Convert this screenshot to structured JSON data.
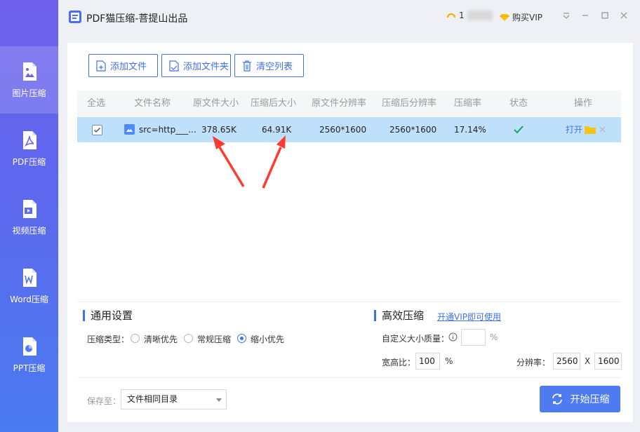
{
  "app": {
    "title": "PDF猫压缩-菩提山出品",
    "user_initial": "1",
    "buy_vip": "购买VIP",
    "min_icon": "minimize-icon",
    "max_icon": "maximize-icon",
    "close_icon": "close-icon",
    "menu_icon": "dropdown-menu-icon"
  },
  "sidebar": {
    "items": [
      {
        "label": "图片压缩",
        "icon": "image-file-icon",
        "active": true
      },
      {
        "label": "PDF压缩",
        "icon": "pdf-file-icon",
        "active": false
      },
      {
        "label": "视频压缩",
        "icon": "video-file-icon",
        "active": false
      },
      {
        "label": "Word压缩",
        "icon": "word-file-icon",
        "active": false
      },
      {
        "label": "PPT压缩",
        "icon": "ppt-file-icon",
        "active": false
      }
    ]
  },
  "toolbar": {
    "add_file": "添加文件",
    "add_folder": "添加文件夹",
    "clear_list": "清空列表"
  },
  "table": {
    "headers": [
      "全选",
      "文件名称",
      "原文件大小",
      "压缩后大小",
      "原文件分辨率",
      "压缩后分辨率",
      "压缩率",
      "状态",
      "操作"
    ],
    "rows": [
      {
        "checked": true,
        "name": "src=http___...",
        "orig_size": "378.65K",
        "comp_size": "64.91K",
        "orig_res": "2560*1600",
        "comp_res": "2560*1600",
        "ratio": "17.14%",
        "status": "check-icon",
        "action_open": "打开"
      }
    ]
  },
  "general": {
    "title": "通用设置",
    "type_label": "压缩类型：",
    "options": [
      {
        "label": "清晰优先",
        "checked": false
      },
      {
        "label": "常规压缩",
        "checked": false
      },
      {
        "label": "缩小优先",
        "checked": true
      }
    ]
  },
  "efficient": {
    "title": "高效压缩",
    "vip_link": "开通VIP即可使用",
    "custom_size_label": "自定义大小质量：",
    "custom_size_value": "",
    "percent": "%",
    "aspect_label": "宽高比：",
    "aspect_value": "100",
    "aspect_unit": "%",
    "resolution_label": "分辨率：",
    "res_width": "2560",
    "res_x": "X",
    "res_height": "1600"
  },
  "footer": {
    "save_label": "保存至：",
    "save_option": "文件相同目录",
    "start_button": "开始压缩"
  },
  "colors": {
    "accent": "#3f73e5",
    "row_highlight": "#bfe0fb",
    "arrow": "#ff3b30",
    "folder": "#f7c21a",
    "status_ok": "#1aa260"
  }
}
